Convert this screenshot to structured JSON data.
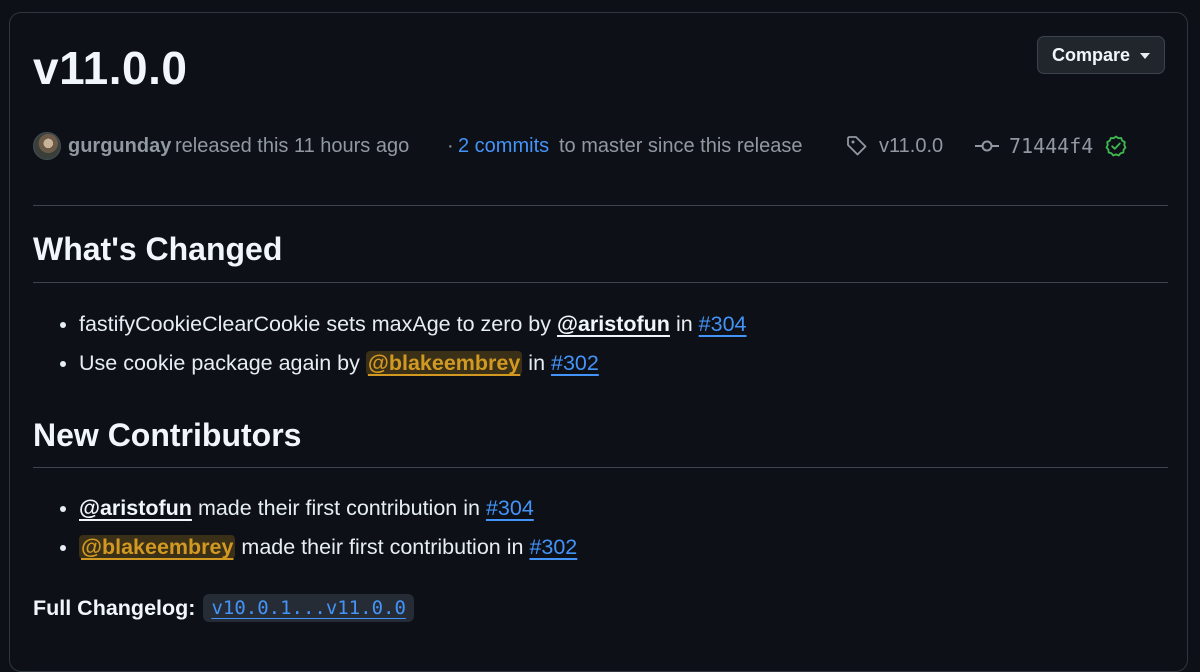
{
  "release": {
    "title": "v11.0.0",
    "compare_label": "Compare",
    "author": "gurgunday",
    "released_text": "released this 11 hours ago",
    "bullet_separator": "·",
    "commits_link": "2 commits",
    "commits_suffix": "to master since this release",
    "tag": "v11.0.0",
    "commit_sha": "71444f4",
    "verified_color": "#3fb950"
  },
  "whats_changed": {
    "heading": "What's Changed",
    "items": [
      {
        "text": "fastifyCookieClearCookie sets maxAge to zero by",
        "user": "@aristofun",
        "in": "in",
        "pr": "#304"
      },
      {
        "text": "Use cookie package again by",
        "user": "@blakeembrey",
        "in": "in",
        "pr": "#302"
      }
    ]
  },
  "new_contributors": {
    "heading": "New Contributors",
    "items": [
      {
        "user": "@aristofun",
        "text": "made their first contribution in",
        "pr": "#304"
      },
      {
        "user": "@blakeembrey",
        "text": "made their first contribution in",
        "pr": "#302"
      }
    ]
  },
  "changelog": {
    "label": "Full Changelog:",
    "range": "v10.0.1...v11.0.0"
  },
  "icons": {
    "tag": "tag-icon",
    "commit": "git-commit-icon",
    "verified": "verified-check-icon",
    "caret": "caret-down-icon"
  }
}
